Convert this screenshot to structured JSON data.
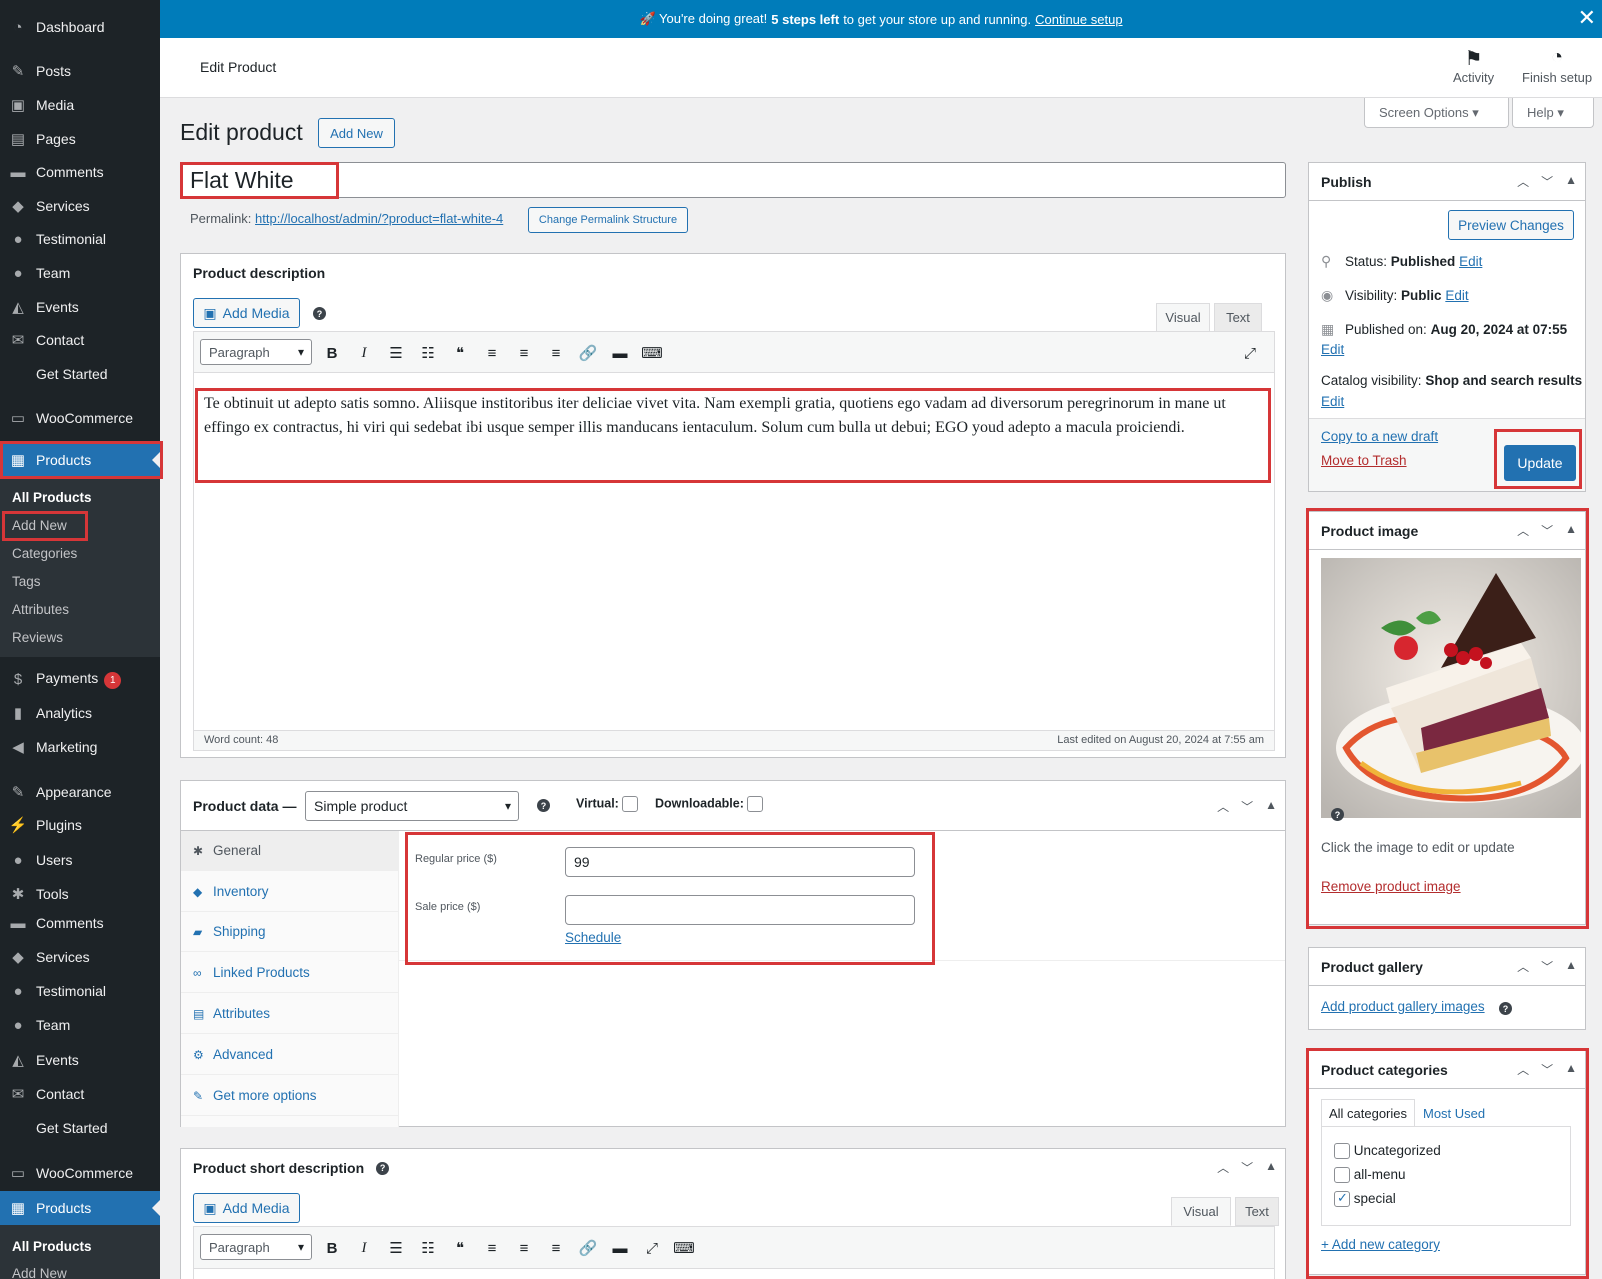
{
  "sidebar": {
    "items": [
      {
        "label": "Dashboard",
        "icon": "dashboard-icon",
        "glyph": "◔"
      },
      {
        "label": "Posts",
        "icon": "pin-icon",
        "glyph": "✎"
      },
      {
        "label": "Media",
        "icon": "media-icon",
        "glyph": "▣"
      },
      {
        "label": "Pages",
        "icon": "pages-icon",
        "glyph": "▤"
      },
      {
        "label": "Comments",
        "icon": "comment-icon",
        "glyph": "▬"
      },
      {
        "label": "Services",
        "icon": "tag-icon",
        "glyph": "◆"
      },
      {
        "label": "Testimonial",
        "icon": "person-icon",
        "glyph": "●"
      },
      {
        "label": "Team",
        "icon": "person-icon",
        "glyph": "●"
      },
      {
        "label": "Events",
        "icon": "grad-icon",
        "glyph": "◭"
      },
      {
        "label": "Contact",
        "icon": "mail-icon",
        "glyph": "✉"
      },
      {
        "label": "Get Started",
        "icon": "",
        "glyph": ""
      },
      {
        "label": "WooCommerce",
        "icon": "woo-icon",
        "glyph": "▭"
      },
      {
        "label": "Products",
        "icon": "archive-icon",
        "glyph": "▦"
      }
    ],
    "sub_items": [
      "All Products",
      "Add New",
      "Categories",
      "Tags",
      "Attributes",
      "Reviews"
    ],
    "items2": [
      {
        "label": "Payments",
        "icon": "dollar-icon",
        "glyph": "$"
      },
      {
        "label": "Analytics",
        "icon": "bar-chart-icon",
        "glyph": "▮"
      },
      {
        "label": "Marketing",
        "icon": "megaphone-icon",
        "glyph": "◀"
      },
      {
        "label": "Appearance",
        "icon": "brush-icon",
        "glyph": "✎"
      },
      {
        "label": "Plugins",
        "icon": "plug-icon",
        "glyph": "⚡"
      },
      {
        "label": "Users",
        "icon": "person-icon",
        "glyph": "●"
      },
      {
        "label": "Tools",
        "icon": "wrench-icon",
        "glyph": "✱"
      },
      {
        "label": "Comments",
        "icon": "comment-icon",
        "glyph": "▬"
      },
      {
        "label": "Services",
        "icon": "tag-icon",
        "glyph": "◆"
      },
      {
        "label": "Testimonial",
        "icon": "person-icon",
        "glyph": "●"
      },
      {
        "label": "Team",
        "icon": "person-icon",
        "glyph": "●"
      },
      {
        "label": "Events",
        "icon": "grad-icon",
        "glyph": "◭"
      },
      {
        "label": "Contact",
        "icon": "mail-icon",
        "glyph": "✉"
      },
      {
        "label": "Get Started",
        "icon": "",
        "glyph": ""
      },
      {
        "label": "WooCommerce",
        "icon": "woo-icon",
        "glyph": "▭"
      },
      {
        "label": "Products",
        "icon": "archive-icon",
        "glyph": "▦"
      }
    ],
    "payments_badge": "1",
    "sub_items2": [
      "All Products",
      "Add New"
    ]
  },
  "banner": {
    "prefix": "🚀 You're doing great!",
    "bold": "5 steps left",
    "suffix": "to get your store up and running.",
    "link": "Continue setup"
  },
  "header": {
    "title": "Edit Product",
    "activity": "Activity",
    "finish_setup": "Finish setup",
    "screen_options": "Screen Options ▾",
    "help": "Help ▾"
  },
  "page": {
    "heading": "Edit product",
    "add_new": "Add New",
    "product_title": "Flat White",
    "permalink_label": "Permalink:",
    "permalink_url": "http://localhost/admin/?product=flat-white-4",
    "change_permalink": "Change Permalink Structure"
  },
  "description": {
    "title": "Product description",
    "add_media": "Add Media",
    "tab_visual": "Visual",
    "tab_text": "Text",
    "format": "Paragraph",
    "content": "Te obtinuit ut adepto satis somno. Aliisque institoribus iter deliciae vivet vita. Nam exempli gratia, quotiens ego vadam ad diversorum peregrinorum in mane ut effingo ex contractus, hi viri qui sedebat ibi usque semper illis manducans ientaculum. Solum cum bulla ut debui; EGO youd adepto a macula proiciendi.",
    "word_count": "Word count: 48",
    "last_edited": "Last edited on August 20, 2024 at 7:55 am"
  },
  "product_data": {
    "title": "Product data —",
    "type": "Simple product",
    "virtual": "Virtual:",
    "downloadable": "Downloadable:",
    "tabs": [
      "General",
      "Inventory",
      "Shipping",
      "Linked Products",
      "Attributes",
      "Advanced",
      "Get more options"
    ],
    "regular_price_label": "Regular price ($)",
    "regular_price": "99",
    "sale_price_label": "Sale price ($)",
    "sale_price": "",
    "schedule": "Schedule"
  },
  "short_description": {
    "title": "Product short description",
    "add_media": "Add Media",
    "tab_visual": "Visual",
    "tab_text": "Text",
    "format": "Paragraph"
  },
  "publish": {
    "title": "Publish",
    "preview": "Preview Changes",
    "status_label": "Status:",
    "status": "Published",
    "visibility_label": "Visibility:",
    "visibility": "Public",
    "published_label": "Published on:",
    "published_on": "Aug 20, 2024 at 07:55",
    "catalog_label": "Catalog visibility:",
    "catalog": "Shop and search results",
    "edit": "Edit",
    "copy_draft": "Copy to a new draft",
    "trash": "Move to Trash",
    "update": "Update"
  },
  "product_image": {
    "title": "Product image",
    "hint": "Click the image to edit or update",
    "remove": "Remove product image"
  },
  "gallery": {
    "title": "Product gallery",
    "add": "Add product gallery images"
  },
  "categories": {
    "title": "Product categories",
    "tab_all": "All categories",
    "tab_most": "Most Used",
    "items": [
      {
        "label": "Uncategorized",
        "checked": false
      },
      {
        "label": "all-menu",
        "checked": false
      },
      {
        "label": "special",
        "checked": true
      }
    ],
    "add_new": "+ Add new category"
  },
  "colors": {
    "accent": "#2271b1",
    "sidebar": "#1d2327",
    "banner": "#007cba",
    "highlight": "#d63638"
  }
}
